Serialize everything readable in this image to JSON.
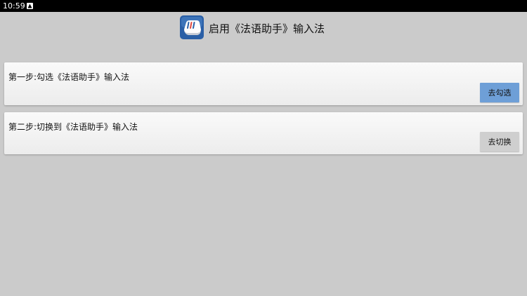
{
  "status_bar": {
    "time": "10:59",
    "notification_icon": "android-notification-icon"
  },
  "header": {
    "app_icon": "keyboard-key-icon",
    "title": "启用《法语助手》输入法"
  },
  "steps": [
    {
      "label": "第一步:勾选《法语助手》输入法",
      "button_label": "去勾选",
      "button_color": "#6e9fd7"
    },
    {
      "label": "第二步:切换到《法语助手》输入法",
      "button_label": "去切换",
      "button_color": "#cfcfcf"
    }
  ],
  "colors": {
    "background": "#cbcbcb",
    "status_bar": "#000000",
    "icon_blue": "#2a5fa6"
  }
}
